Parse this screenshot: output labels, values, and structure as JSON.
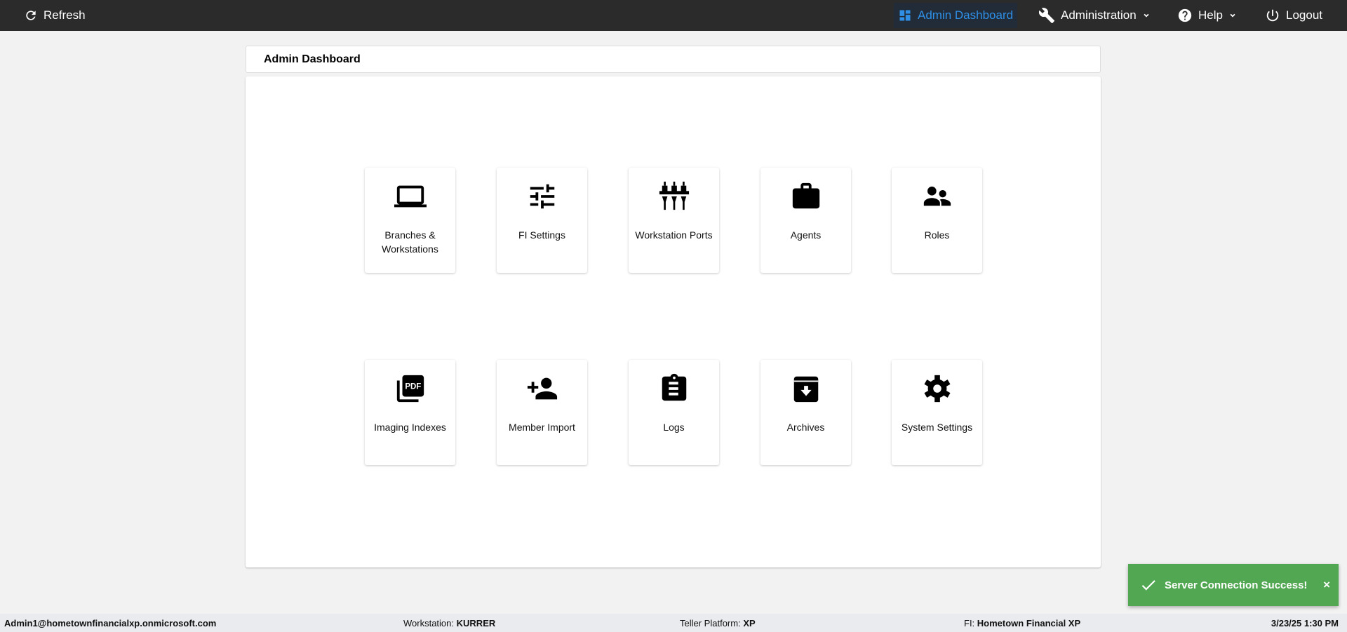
{
  "topbar": {
    "refresh": "Refresh",
    "admin_dashboard": "Admin Dashboard",
    "administration": "Administration",
    "help": "Help",
    "logout": "Logout",
    "accent": "#2f8fe6"
  },
  "header": {
    "title": "Admin Dashboard"
  },
  "tiles": [
    {
      "label": "Branches & Workstations",
      "icon": "laptop-icon"
    },
    {
      "label": "FI Settings",
      "icon": "tune-icon"
    },
    {
      "label": "Workstation Ports",
      "icon": "ports-icon"
    },
    {
      "label": "Agents",
      "icon": "briefcase-icon"
    },
    {
      "label": "Roles",
      "icon": "people-icon"
    },
    {
      "label": "Imaging Indexes",
      "icon": "pdf-icon"
    },
    {
      "label": "Member Import",
      "icon": "person-add-icon"
    },
    {
      "label": "Logs",
      "icon": "clipboard-icon"
    },
    {
      "label": "Archives",
      "icon": "archive-icon"
    },
    {
      "label": "System Settings",
      "icon": "gear-icon"
    }
  ],
  "toast": {
    "message": "Server Connection Success!",
    "close": "×",
    "color": "#52a752"
  },
  "footer": {
    "user": "Admin1@hometownfinancialxp.onmicrosoft.com",
    "workstation_label": "Workstation:",
    "workstation": "KURRER",
    "platform_label": "Teller Platform:",
    "platform": "XP",
    "fi_label": "FI:",
    "fi": "Hometown Financial XP",
    "datetime": "3/23/25 1:30 PM"
  }
}
